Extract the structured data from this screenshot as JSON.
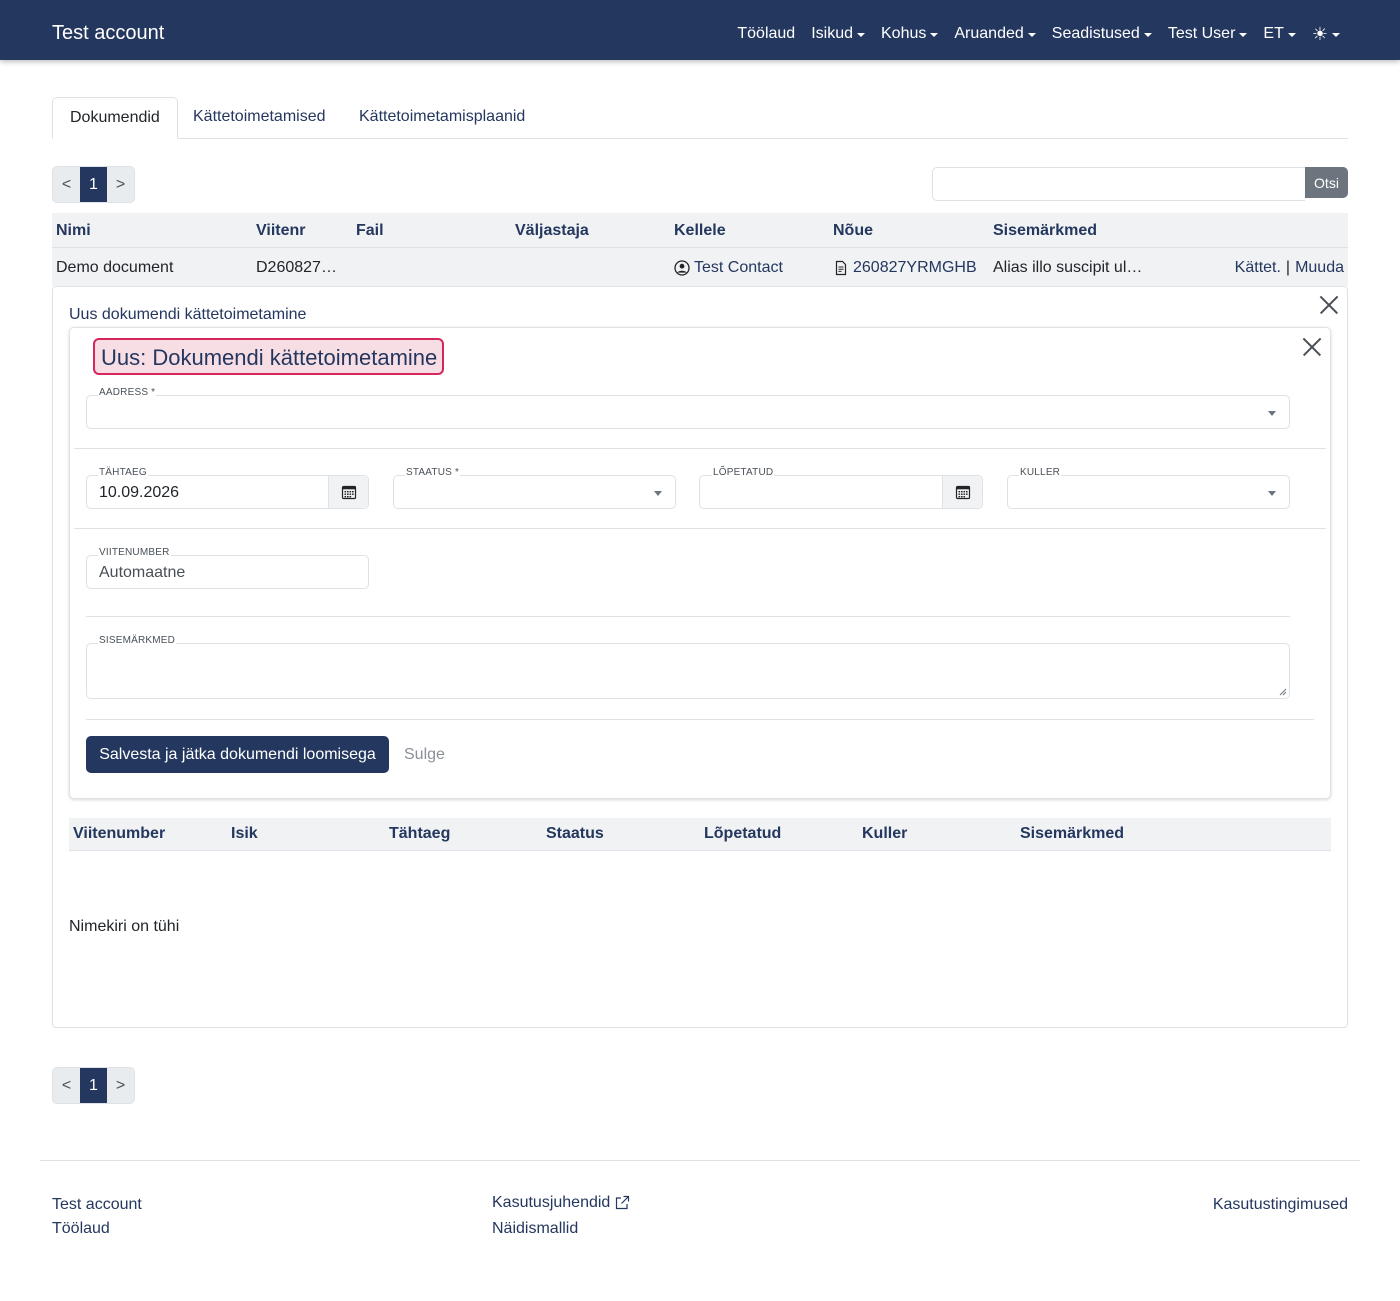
{
  "navbar": {
    "brand": "Test account",
    "items": [
      "Töölaud",
      "Isikud",
      "Kohus",
      "Aruanded",
      "Seadistused",
      "Test User",
      "ET"
    ],
    "theme_icon": "sun-icon",
    "bg_color": "#24375e"
  },
  "tabs": [
    "Dokumendid",
    "Kättetoimetamised",
    "Kättetoimetamisplaanid"
  ],
  "pagination": {
    "prev": "<",
    "current": "1",
    "next": ">"
  },
  "search": {
    "value": "",
    "button": "Otsi"
  },
  "table": {
    "headers": [
      "Nimi",
      "Viitenr",
      "Fail",
      "Väljastaja",
      "Kellele",
      "Nõue",
      "Sisemärkmed"
    ],
    "row": {
      "nimi": "Demo document",
      "viitenr": "D260827…",
      "fail": "",
      "valjastaja": "",
      "kellele": "Test Contact",
      "noue": "260827YRMGHB",
      "sisemarkmed": "Alias illo suscipit ul…",
      "action_kattet": "Kättet.",
      "action_sep": "|",
      "action_muuda": "Muuda"
    }
  },
  "panel": {
    "title": "Uus dokumendi kättetoimetamine",
    "form": {
      "title": "Uus: Dokumendi kättetoimetamine",
      "aadress_label": "AADRESS *",
      "aadress_value": "",
      "tahtaeg_label": "TÄHTAEG",
      "tahtaeg_value": "10.09.2026",
      "staatus_label": "STAATUS *",
      "staatus_value": "",
      "lopetatud_label": "LÕPETATUD",
      "lopetatud_value": "",
      "kuller_label": "KULLER",
      "kuller_value": "",
      "viitenumber_label": "VIITENUMBER",
      "viitenumber_value": "Automaatne",
      "sisemarkmed_label": "SISEMÄRKMED",
      "sisemarkmed_value": "",
      "save_button": "Salvesta ja jätka dokumendi loomisega",
      "close_button": "Sulge"
    },
    "sub_table": {
      "headers": [
        "Viitenumber",
        "Isik",
        "Tähtaeg",
        "Staatus",
        "Lõpetatud",
        "Kuller",
        "Sisemärkmed"
      ],
      "empty_text": "Nimekiri on tühi"
    }
  },
  "footer": {
    "left": [
      "Test account",
      "Töölaud"
    ],
    "middle": [
      "Kasutusjuhendid",
      "Näidismallid"
    ],
    "right": "Kasutustingimused"
  }
}
